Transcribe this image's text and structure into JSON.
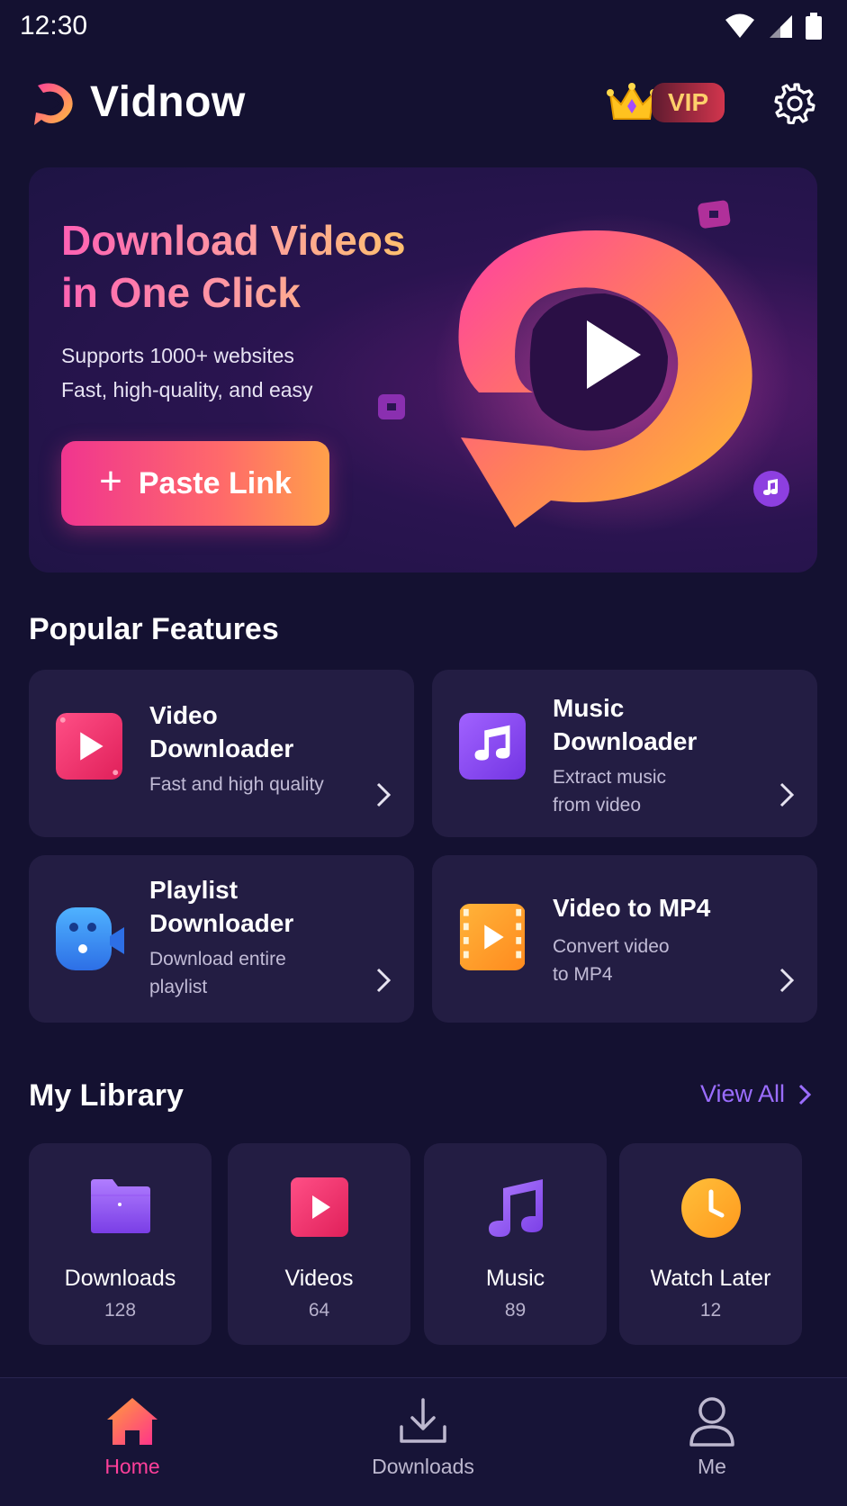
{
  "status_bar": {
    "time": "12:30"
  },
  "header": {
    "app_name": "Vidnow",
    "vip_label": "VIP"
  },
  "hero": {
    "title_line1": "Download Videos",
    "title_line2": "in One Click",
    "subtitle_line1": "Supports 1000+ websites",
    "subtitle_line2": "Fast, high-quality, and easy",
    "button_label": "Paste Link"
  },
  "popular": {
    "section_title": "Popular Features",
    "features": [
      {
        "title_line1": "Video",
        "title_line2": "Downloader",
        "desc_line1": "Fast and high quality",
        "desc_line2": "",
        "icon": "video-play-icon"
      },
      {
        "title_line1": "Music",
        "title_line2": "Downloader",
        "desc_line1": "Extract music",
        "desc_line2": "from video",
        "icon": "music-note-icon"
      },
      {
        "title_line1": "Playlist",
        "title_line2": "Downloader",
        "desc_line1": "Download entire",
        "desc_line2": "playlist",
        "icon": "playlist-camera-icon"
      },
      {
        "title_line1": "Video to MP4",
        "title_line2": "",
        "desc_line1": "Convert video",
        "desc_line2": "to MP4",
        "icon": "film-strip-icon"
      }
    ]
  },
  "library": {
    "section_title": "My Library",
    "view_all_label": "View All",
    "items": [
      {
        "label": "Downloads",
        "count": "128",
        "icon": "folder-icon"
      },
      {
        "label": "Videos",
        "count": "64",
        "icon": "video-play-icon"
      },
      {
        "label": "Music",
        "count": "89",
        "icon": "music-note-icon"
      },
      {
        "label": "Watch Later",
        "count": "12",
        "icon": "clock-icon"
      }
    ]
  },
  "bottom_nav": {
    "items": [
      {
        "label": "Home",
        "active": true,
        "icon": "home-icon"
      },
      {
        "label": "Downloads",
        "active": false,
        "icon": "download-icon"
      },
      {
        "label": "Me",
        "active": false,
        "icon": "profile-icon"
      }
    ]
  },
  "colors": {
    "background": "#141131",
    "card": "#231d43",
    "accent_pink": "#f0358f",
    "accent_orange": "#ffa04a",
    "accent_purple": "#9b6dff",
    "vip_gold": "#ffcf6b"
  }
}
